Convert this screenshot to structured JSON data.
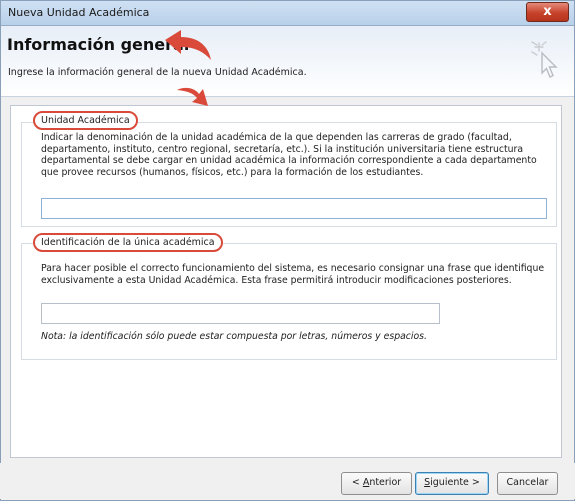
{
  "window": {
    "title": "Nueva Unidad Académica",
    "close_label": "x"
  },
  "header": {
    "title": "Información general",
    "subtitle": "Ingrese la información general de la nueva Unidad Académica.",
    "icon": "wizard-wand-icon"
  },
  "sections": [
    {
      "label": "Unidad Académica",
      "description": "Indicar la denominación de la unidad académica de la que dependen las carreras de grado (facultad, departamento, instituto, centro regional, secretaría, etc.). Si la institución universitaria tiene estructura departamental se debe cargar en unidad académica la información correspondiente a cada departamento que provee recursos (humanos, físicos, etc.) para la formación de los estudiantes.",
      "value": ""
    },
    {
      "label": "Identificación de la única académica",
      "description": "Para hacer posible el correcto funcionamiento del sistema, es necesario consignar una frase que identifique exclusivamente a esta Unidad Académica. Esta frase permitirá introducir modificaciones posteriores.",
      "value": "",
      "note": "Nota: la identificación sólo puede estar compuesta por letras, números y espacios."
    }
  ],
  "buttons": {
    "prev": {
      "pre": "< ",
      "key": "A",
      "post": "nterior"
    },
    "next": {
      "key": "S",
      "post": "iguiente >"
    },
    "cancel": "Cancelar"
  },
  "annotation_color": "#d94a3a"
}
